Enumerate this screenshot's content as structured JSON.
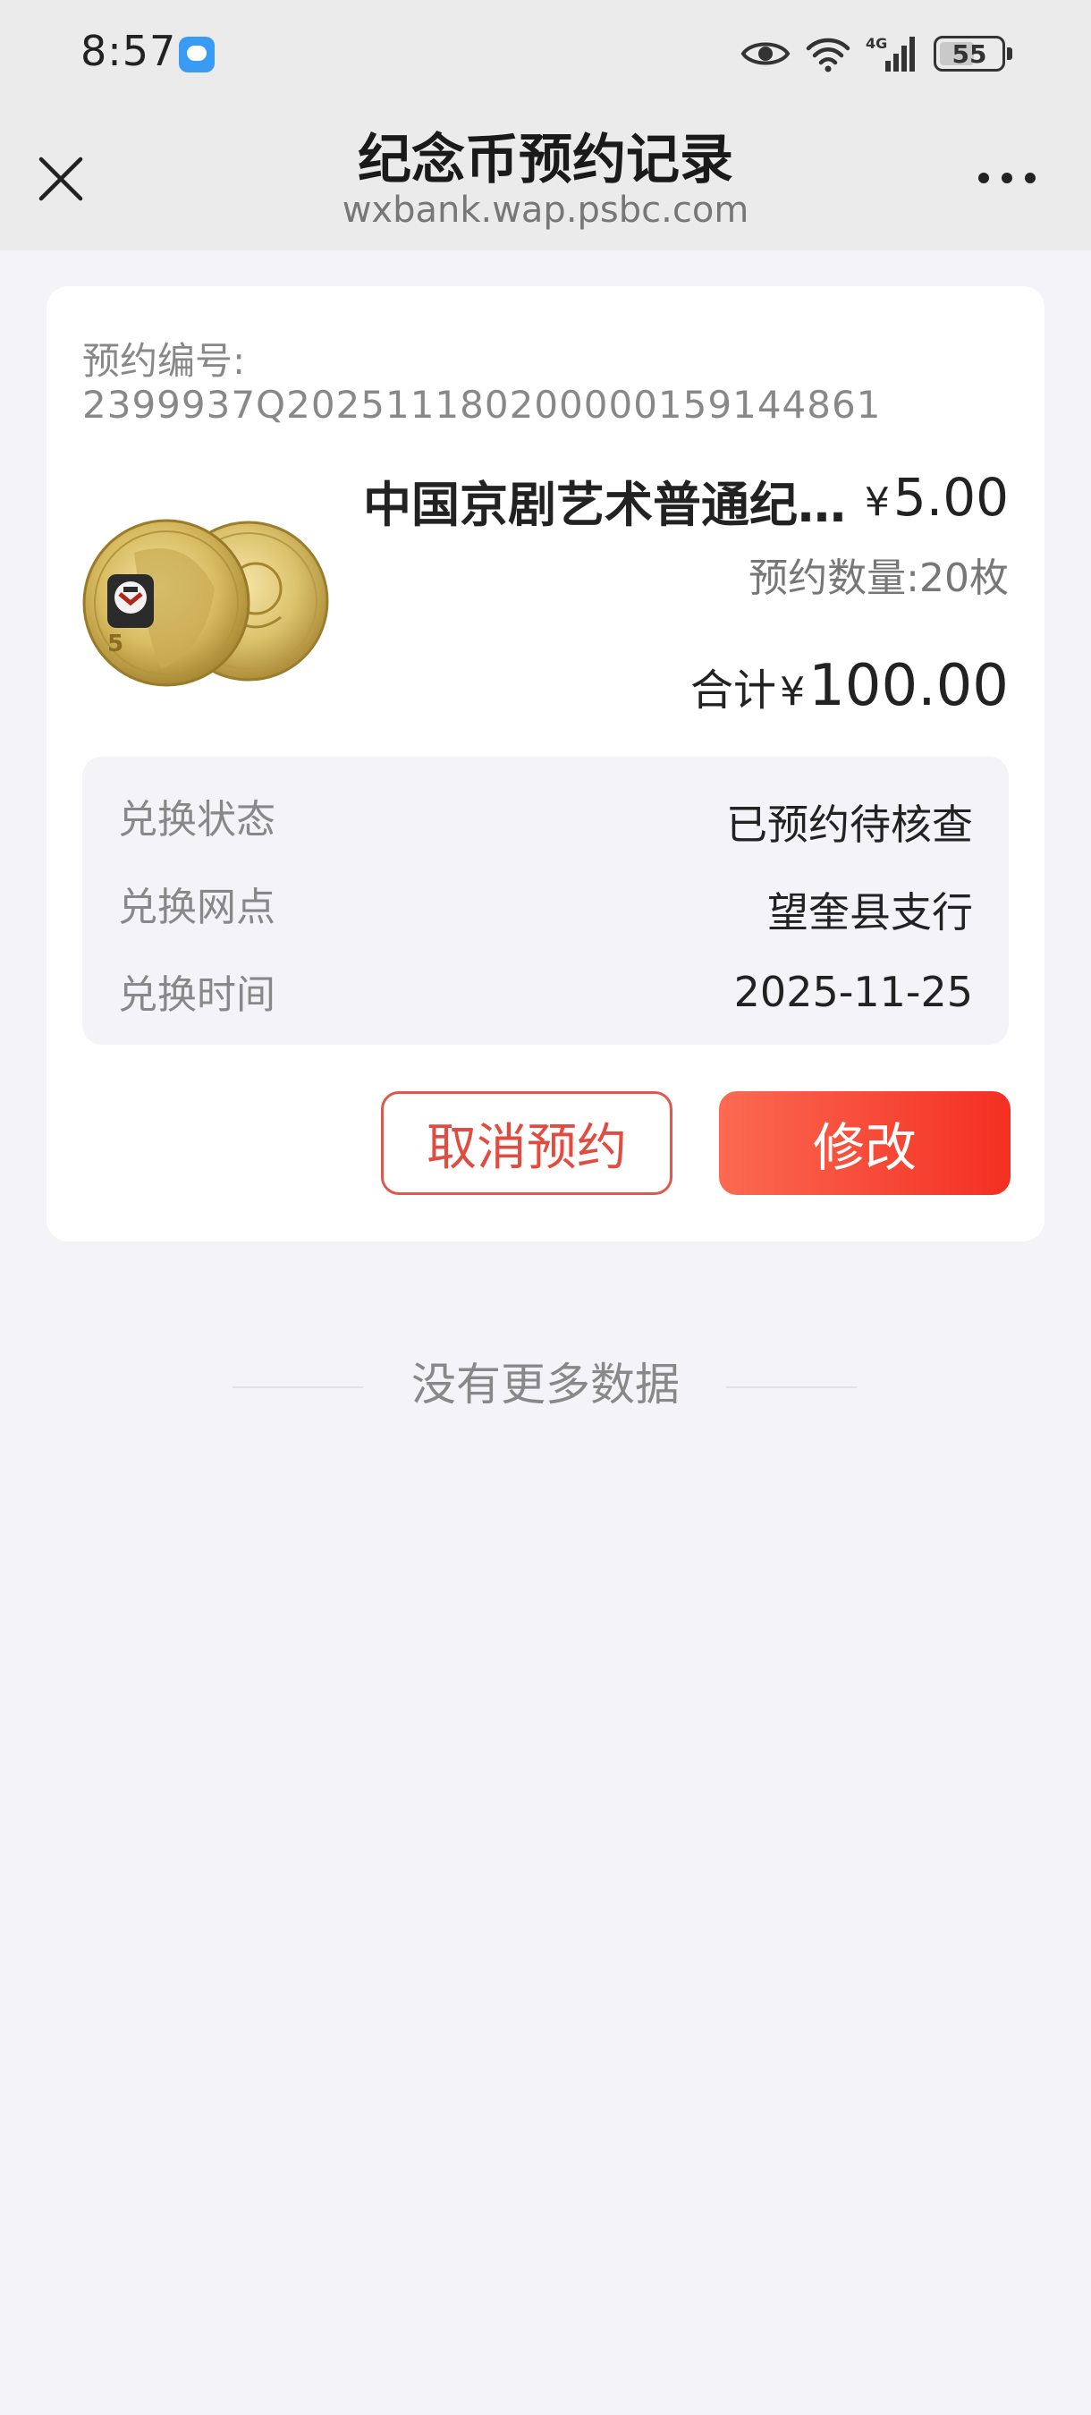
{
  "status_bar": {
    "time": "8:57",
    "network": "4G",
    "battery": "55"
  },
  "nav": {
    "title": "纪念币预约记录",
    "subtitle": "wxbank.wap.psbc.com"
  },
  "reservation": {
    "order_label": "预约编号:",
    "order_number": "2399937Q20251118020000015914486​1",
    "product_name": "中国京剧艺术普通纪念币",
    "price_symbol": "¥",
    "price": "5.00",
    "qty_label": "预约数量:",
    "qty_value": "20枚",
    "total_label": "合计",
    "total_symbol": "¥",
    "total_amount": "100.00",
    "details": [
      {
        "label": "兑换状态",
        "value": "已预约待核查"
      },
      {
        "label": "兑换网点",
        "value": "望奎县支行"
      },
      {
        "label": "兑换时间",
        "value": "2025-11-25"
      }
    ],
    "cancel_label": "取消预约",
    "modify_label": "修改"
  },
  "footer": {
    "no_more": "没有更多数据"
  },
  "colors": {
    "accent": "#f42f22",
    "accent_light": "#fb6a52",
    "page_bg": "#f3f3f8",
    "header_bg": "#ebebeb"
  },
  "icons": {
    "close": "close-icon",
    "more": "more-icon",
    "coin": "commemorative-coin-image"
  }
}
